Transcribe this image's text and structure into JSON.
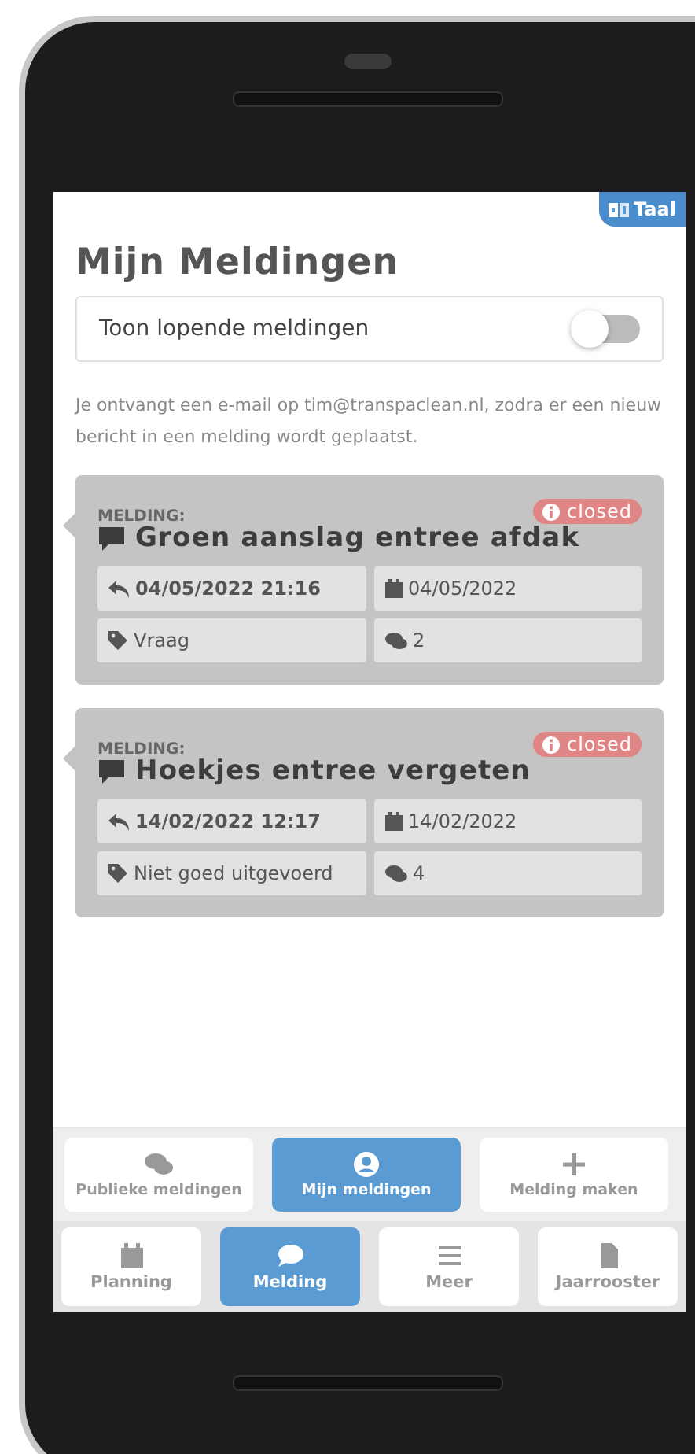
{
  "language_button": {
    "label": "Taal"
  },
  "title": "Mijn Meldingen",
  "toggle": {
    "label": "Toon lopende meldingen",
    "on": false
  },
  "info_text": "Je ontvangt een e-mail op tim@transpaclean.nl, zodra er een nieuw bericht in een melding wordt geplaatst.",
  "meldingen": [
    {
      "label": "MELDING:",
      "status": "closed",
      "title": "Groen aanslag entree afdak",
      "last_reply": "04/05/2022 21:16",
      "date": "04/05/2022",
      "category": "Vraag",
      "comments": "2"
    },
    {
      "label": "MELDING:",
      "status": "closed",
      "title": "Hoekjes entree vergeten",
      "last_reply": "14/02/2022 12:17",
      "date": "14/02/2022",
      "category": "Niet goed uitgevoerd",
      "comments": "4"
    }
  ],
  "sub_tabs": [
    {
      "label": "Publieke meldingen",
      "kind": "comments",
      "selected": false
    },
    {
      "label": "Mijn meldingen",
      "kind": "user",
      "selected": true
    },
    {
      "label": "Melding maken",
      "kind": "plus",
      "selected": false
    }
  ],
  "nav_tabs": [
    {
      "label": "Planning",
      "kind": "calendar",
      "selected": false
    },
    {
      "label": "Melding",
      "kind": "comment",
      "selected": true
    },
    {
      "label": "Meer",
      "kind": "bars",
      "selected": false
    },
    {
      "label": "Jaarrooster",
      "kind": "file",
      "selected": false
    }
  ]
}
